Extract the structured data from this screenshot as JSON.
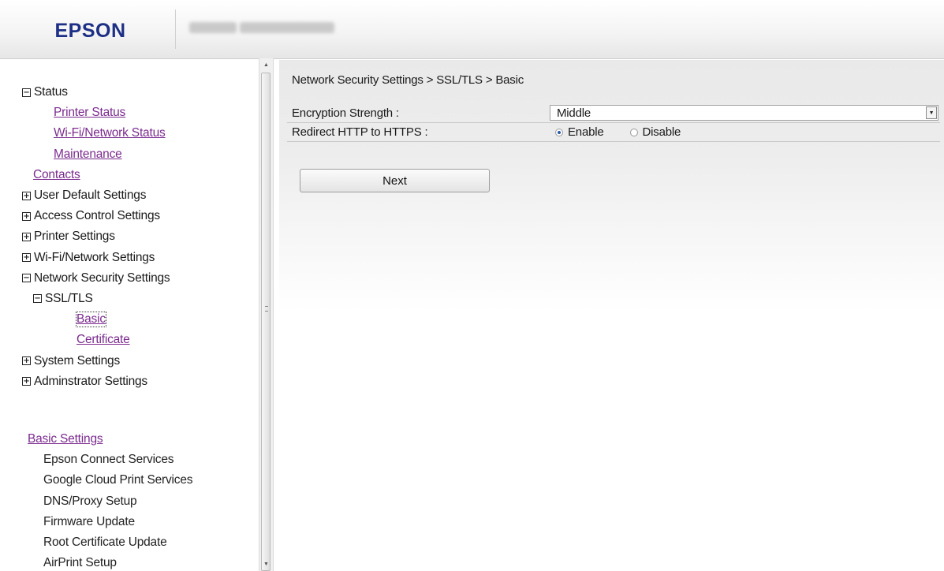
{
  "header": {
    "logo": "EPSON",
    "model_name": ""
  },
  "sidebar": {
    "status": "Status",
    "printer_status": "Printer Status",
    "wifi_network_status": "Wi-Fi/Network Status",
    "maintenance": "Maintenance",
    "contacts": "Contacts",
    "user_default_settings": "User Default Settings",
    "access_control_settings": "Access Control Settings",
    "printer_settings": "Printer Settings",
    "wifi_network_settings": "Wi-Fi/Network Settings",
    "network_security_settings": "Network Security Settings",
    "ssl_tls": "SSL/TLS",
    "basic": "Basic",
    "certificate": "Certificate",
    "system_settings": "System Settings",
    "administrator_settings": "Adminstrator Settings",
    "basic_settings": "Basic Settings",
    "basic_items": [
      "Epson Connect Services",
      "Google Cloud Print Services",
      "DNS/Proxy Setup",
      "Firmware Update",
      "Root Certificate Update",
      "AirPrint Setup"
    ]
  },
  "main": {
    "breadcrumb": "Network Security Settings > SSL/TLS > Basic",
    "encryption_label": "Encryption Strength :",
    "encryption_value": "Middle",
    "redirect_label": "Redirect HTTP to HTTPS :",
    "redirect_enable": "Enable",
    "redirect_disable": "Disable",
    "redirect_selected": "Enable",
    "next_button": "Next"
  },
  "colors": {
    "logo": "#1d2f86",
    "link": "#7b2b8f",
    "radio_selected": "#2a5aa8"
  },
  "icons": {
    "expanded_toggle": "minus-box-icon",
    "collapsed_toggle": "plus-box-icon",
    "select_arrow": "chevron-down-icon",
    "scroll_up": "triangle-up-icon",
    "scroll_down": "triangle-down-icon"
  }
}
